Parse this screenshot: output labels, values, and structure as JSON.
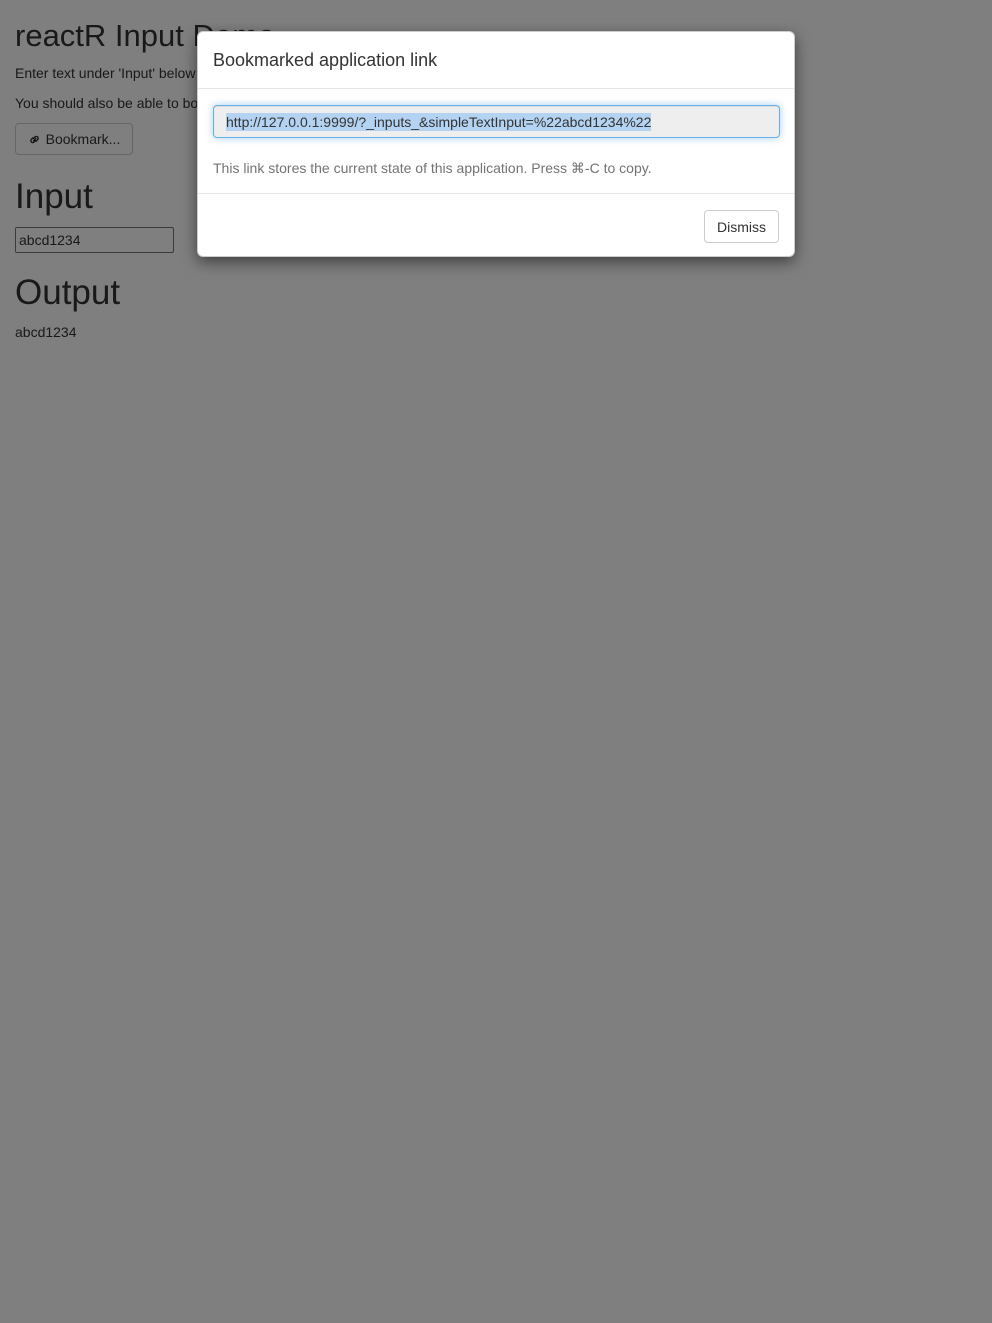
{
  "app": {
    "title": "reactR Input Demo",
    "instruction_1": "Enter text under 'Input' below",
    "instruction_2": "You should also be able to bookmark",
    "bookmark_button_label": "Bookmark...",
    "bookmark_icon": "link-icon"
  },
  "input_section": {
    "heading": "Input",
    "value": "abcd1234"
  },
  "output_section": {
    "heading": "Output",
    "value": "abcd1234"
  },
  "modal": {
    "title": "Bookmarked application link",
    "url": "http://127.0.0.1:9999/?_inputs_&simpleTextInput=%22abcd1234%22",
    "help_text": "This link stores the current state of this application. Press ⌘-C to copy.",
    "dismiss_label": "Dismiss"
  },
  "colors": {
    "backdrop": "#000000",
    "selection": "#b4d3f2",
    "focus_border": "#66afe9"
  }
}
